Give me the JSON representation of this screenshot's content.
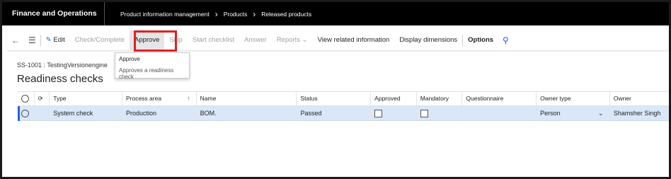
{
  "app": {
    "title": "Finance and Operations"
  },
  "breadcrumb": [
    "Product information management",
    "Products",
    "Released products"
  ],
  "toolbar": {
    "edit": "Edit",
    "check_complete": "Check/Complete",
    "approve": "Approve",
    "skip": "Skip",
    "start_checklist": "Start checklist",
    "answer": "Answer",
    "reports": "Reports",
    "view_related": "View related information",
    "display_dimensions": "Display dimensions",
    "options": "Options"
  },
  "flyout": {
    "title": "Approve",
    "description": "Approves a readiness check"
  },
  "record": {
    "id": "SS-1001 : TestingVersionengine",
    "title": "Readiness checks"
  },
  "grid": {
    "columns": [
      "Type",
      "Process area",
      "Name",
      "Status",
      "Approved",
      "Mandatory",
      "Questionnaire",
      "Owner type",
      "Owner"
    ],
    "rows": [
      {
        "type": "System check",
        "process_area": "Production",
        "name": "BOM.",
        "status": "Passed",
        "approved": false,
        "mandatory": false,
        "questionnaire": "",
        "owner_type": "Person",
        "owner": "Shamsher Singh"
      }
    ]
  },
  "colors": {
    "accent": "#1f5fbf",
    "highlight": "#e02020",
    "selected_row": "#d9e7f8",
    "topbar": "#000000"
  }
}
